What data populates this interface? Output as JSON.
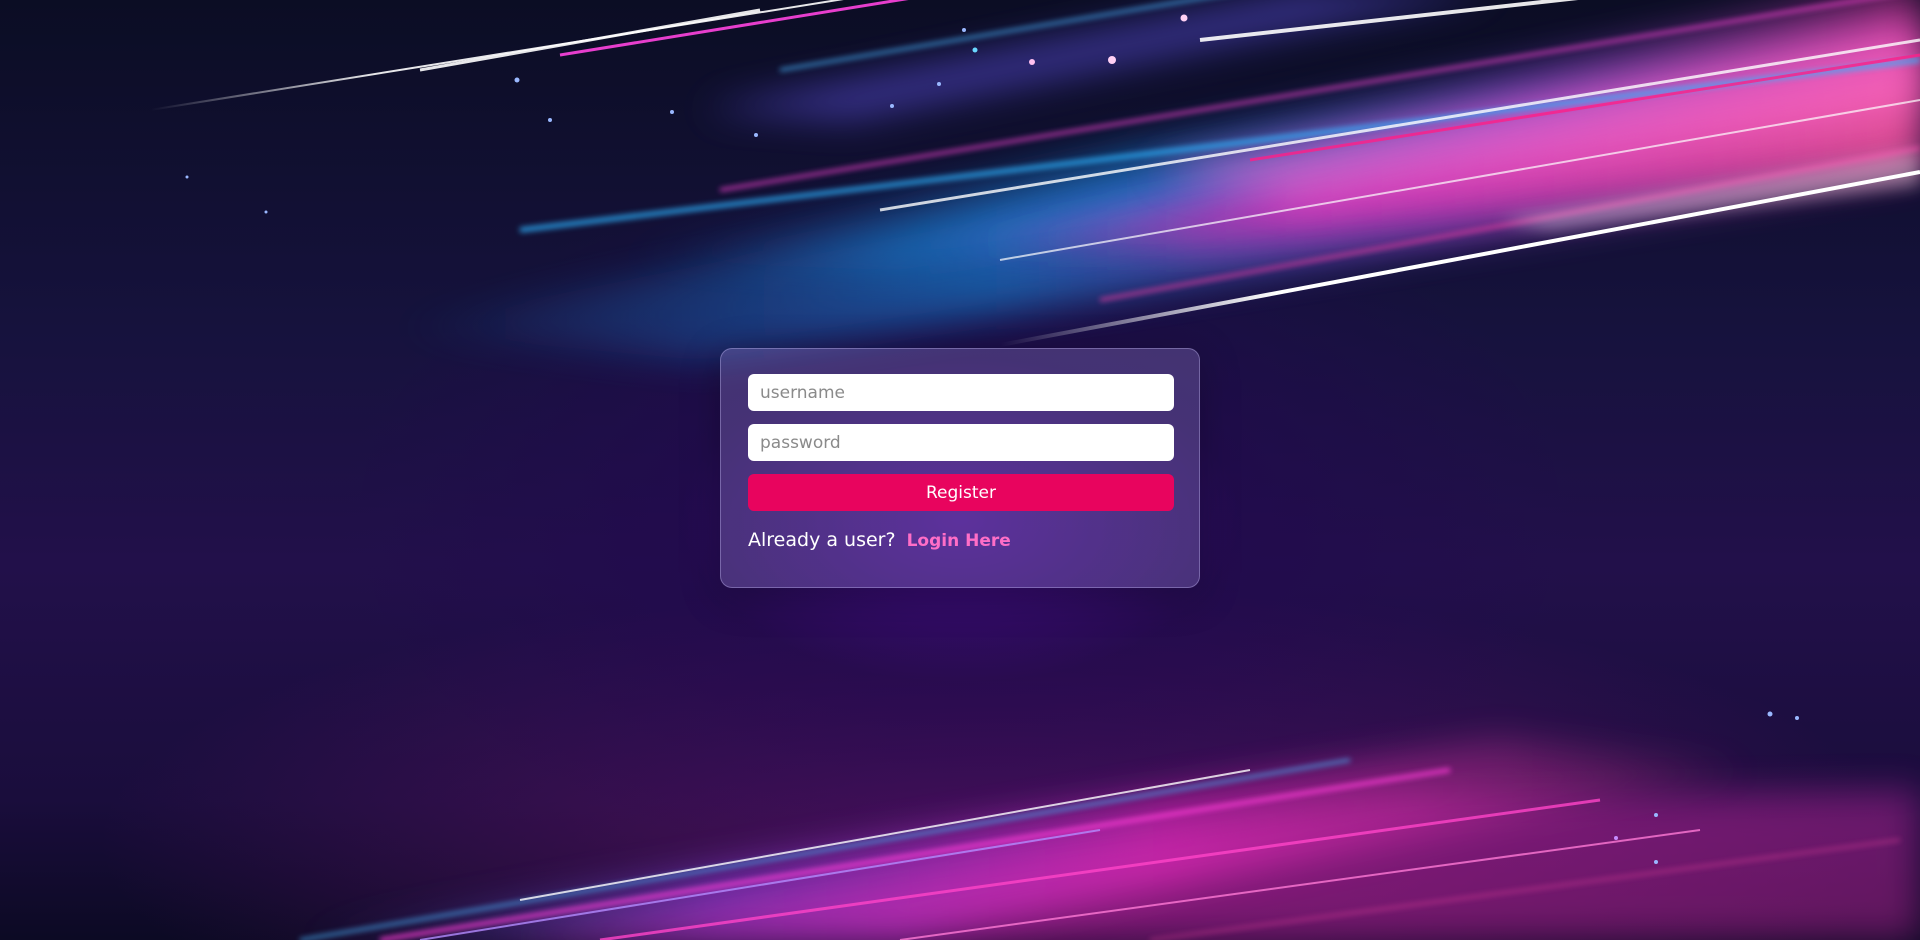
{
  "form": {
    "username_placeholder": "username",
    "password_placeholder": "password",
    "register_label": "Register",
    "already_text": "Already a user?",
    "login_link": "Login Here"
  },
  "colors": {
    "register_button": "#e8045e",
    "login_link": "#ff6ec7",
    "card_background": "rgba(160,140,220,0.30)"
  }
}
